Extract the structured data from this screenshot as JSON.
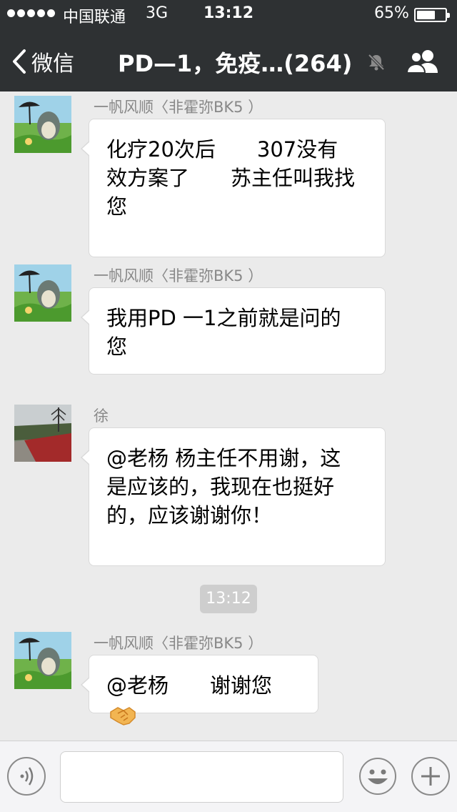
{
  "status_bar": {
    "carrier": "中国联通",
    "network": "3G",
    "time": "13:12",
    "battery_percent": "65%",
    "battery_level": 0.65
  },
  "nav": {
    "back_label": "微信",
    "title": "PD—1，免疫…(264)",
    "back_icon": "chevron-left-icon",
    "mute_icon": "bell-muted-icon",
    "group_icon": "group-members-icon"
  },
  "messages": [
    {
      "sender": "一帆风顺〈非霍弥BK5 ）",
      "text": "化疗20次后　　307没有\n效方案了　　苏主任叫我找\n您",
      "avatar": "totoro-avatar"
    },
    {
      "sender": "一帆风顺〈非霍弥BK5 ）",
      "text": "我用PD 一1之前就是问的\n您",
      "avatar": "totoro-avatar"
    },
    {
      "sender": "徐",
      "text": "@老杨 杨主任不用谢，这\n是应该的，我现在也挺好\n的，应该谢谢你！",
      "avatar": "garden-avatar"
    },
    {
      "sender": "一帆风顺〈非霍弥BK5 ）",
      "text": "@老杨　　谢谢您",
      "avatar": "totoro-avatar",
      "emoji": "handshake-icon"
    }
  ],
  "timestamp": "13:12",
  "input_bar": {
    "voice_icon": "voice-icon",
    "emoji_icon": "smiley-icon",
    "plus_icon": "plus-icon"
  },
  "colors": {
    "nav_background": "#2e3133",
    "chat_background": "#ebebeb",
    "bubble": "#ffffff",
    "sender_text": "#888888"
  }
}
